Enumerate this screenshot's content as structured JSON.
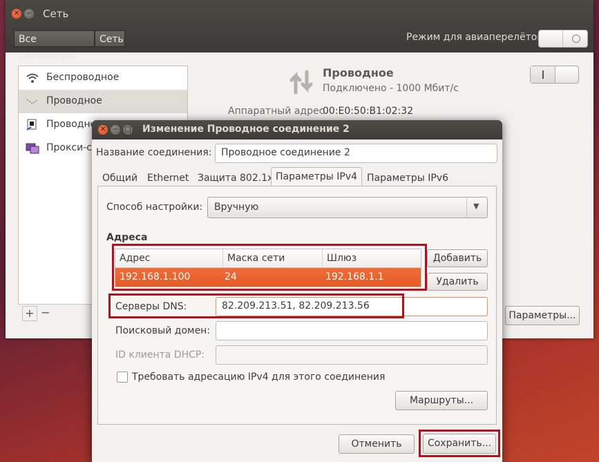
{
  "outer": {
    "title": "Сеть",
    "breadcrumbs": [
      "Все параметры",
      "Сеть"
    ],
    "airplane_label": "Режим для авиаперелётов",
    "sidebar": [
      {
        "label": "Беспроводное",
        "icon": "wifi-icon"
      },
      {
        "label": "Проводное",
        "icon": "wired-icon"
      },
      {
        "label": "Проводно",
        "icon": "vpn-icon"
      },
      {
        "label": "Прокси-се",
        "icon": "proxy-icon"
      }
    ],
    "toolbar": {
      "add": "+",
      "remove": "−"
    },
    "detail": {
      "title": "Проводное",
      "status": "Подключено - 1000 Мбит/с",
      "hw_label": "Аппаратный адрес",
      "hw_value": "00:E0:50:B1:02:32",
      "params_button": "Параметры..."
    }
  },
  "dialog": {
    "title": "Изменение Проводное соединение 2",
    "name_label": "Название соединения:",
    "name_value": "Проводное соединение 2",
    "tabs": [
      "Общий",
      "Ethernet",
      "Защита 802.1x",
      "Параметры IPv4",
      "Параметры IPv6"
    ],
    "active_tab": "Параметры IPv4",
    "method_label": "Способ настройки:",
    "method_value": "Вручную",
    "addresses_heading": "Адреса",
    "table": {
      "columns": [
        "Адрес",
        "Маска сети",
        "Шлюз"
      ],
      "rows": [
        [
          "192.168.1.100",
          "24",
          "192.168.1.1"
        ]
      ]
    },
    "add_button": "Добавить",
    "delete_button": "Удалить",
    "dns_label": "Серверы DNS:",
    "dns_value": "82.209.213.51, 82.209.213.56",
    "search_label": "Поисковый домен:",
    "search_value": "",
    "dhcp_label": "ID клиента DHCP:",
    "dhcp_value": "",
    "require_ipv4_label": "Требовать адресацию IPv4 для этого соединения",
    "require_ipv4_checked": false,
    "routes_button": "Маршруты...",
    "cancel_button": "Отменить",
    "save_button": "Сохранить..."
  },
  "colors": {
    "selection": "#e9602e",
    "highlight_box": "#b3121d",
    "accent": "#dd4814"
  }
}
